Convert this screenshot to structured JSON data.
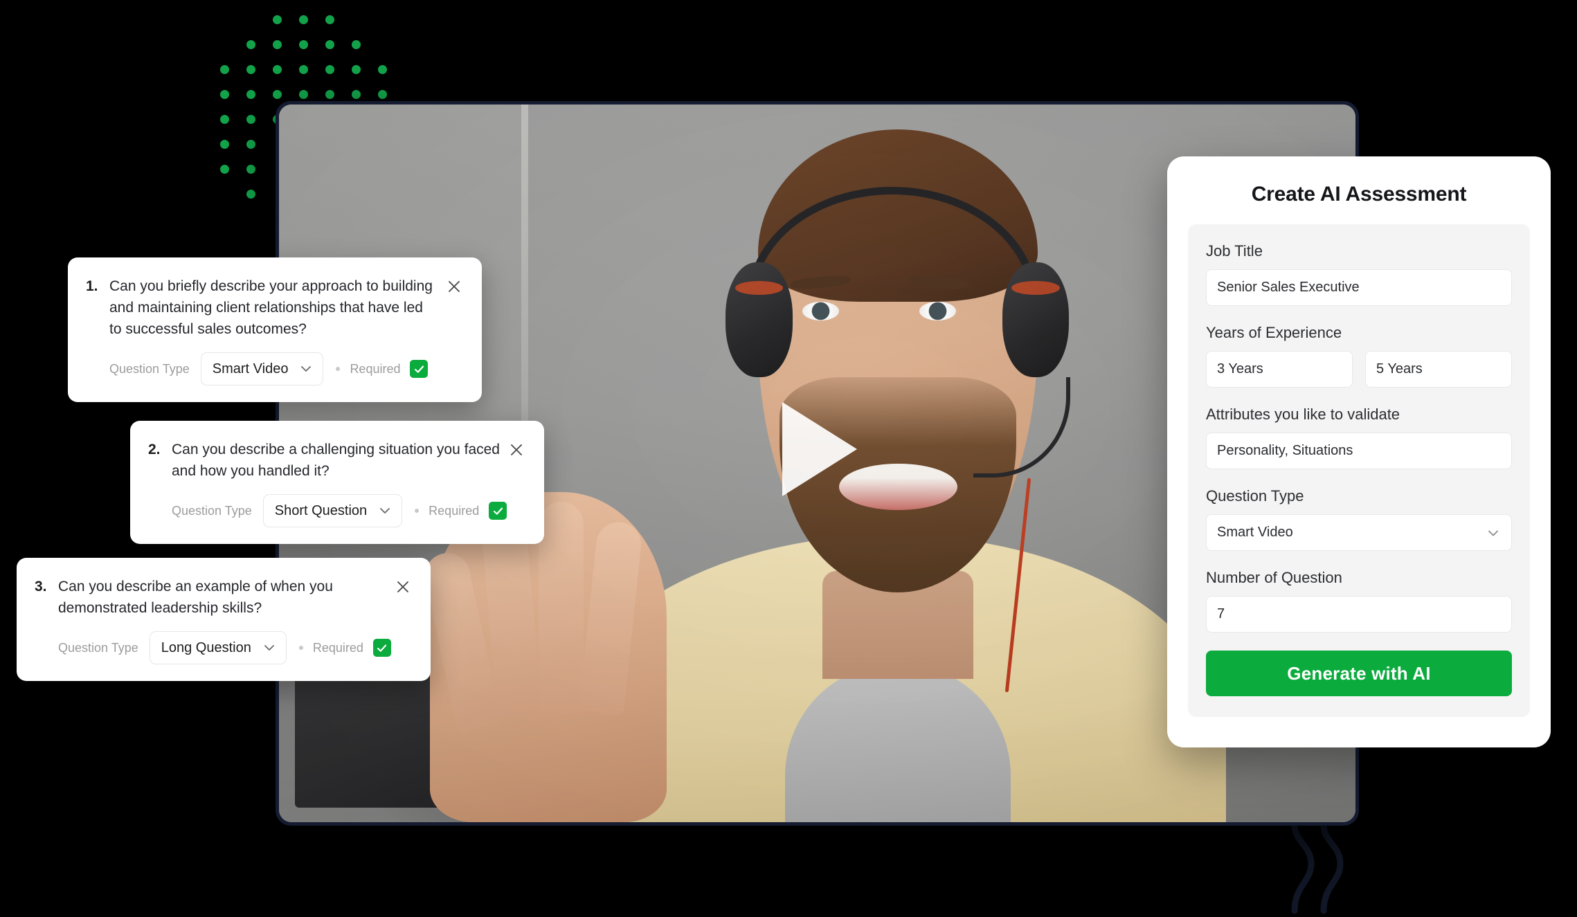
{
  "panel": {
    "title": "Create AI Assessment",
    "fields": [
      {
        "label": "Job Title",
        "value": "Senior Sales Executive",
        "type": "text"
      },
      {
        "label": "Years of Experience",
        "value_min": "3 Years",
        "value_max": "5 Years",
        "type": "range"
      },
      {
        "label": "Attributes you like to validate",
        "value": "Personality, Situations",
        "type": "text"
      },
      {
        "label": "Question Type",
        "value": "Smart Video",
        "type": "select"
      },
      {
        "label": "Number of Question",
        "value": "7",
        "type": "text"
      }
    ],
    "job_title_label": "Job Title",
    "job_title_value": "Senior Sales Executive",
    "years_label": "Years of Experience",
    "years_min": "3 Years",
    "years_max": "5 Years",
    "attributes_label": "Attributes you like to validate",
    "attributes_value": "Personality, Situations",
    "question_type_label": "Question Type",
    "question_type_value": "Smart Video",
    "number_label": "Number of Question",
    "number_value": "7",
    "generate_label": "Generate with AI",
    "accent_color": "#0bab3d"
  },
  "questions": [
    {
      "number": "1.",
      "text": "Can you briefly describe your approach to building and maintaining client relationships that have led to successful sales outcomes?",
      "type_label": "Question Type",
      "type_value": "Smart Video",
      "required_label": "Required",
      "required": true
    },
    {
      "number": "2.",
      "text": "Can you describe a challenging situation you faced and how you handled it?",
      "type_label": "Question Type",
      "type_value": "Short Question",
      "required_label": "Required",
      "required": true
    },
    {
      "number": "3.",
      "text": "Can you describe an example of when you demonstrated leadership skills?",
      "type_label": "Question Type",
      "type_value": "Long  Question",
      "required_label": "Required",
      "required": true
    }
  ],
  "video": {
    "play_icon": "play-triangle-icon"
  },
  "decor": {
    "dot_color": "#12a24a",
    "background_color": "#000000",
    "frame_color": "#151c31"
  }
}
